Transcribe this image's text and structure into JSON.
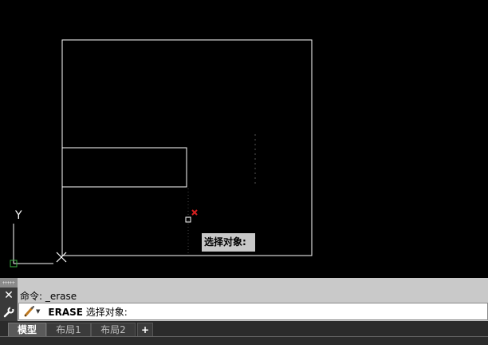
{
  "drawing": {
    "tooltip_text": "选择对象:",
    "ucs_y_label": "Y",
    "line_color": "#ffffff",
    "pickbox_color": "#ffffff",
    "marker_color": "#d42020"
  },
  "command_panel": {
    "history_line": "命令: _erase",
    "command_name": "ERASE",
    "prompt": " 选择对象:"
  },
  "layout_tabs": [
    {
      "label": "模型",
      "active": true
    },
    {
      "label": "布局1",
      "active": false
    },
    {
      "label": "布局2",
      "active": false
    },
    {
      "label": "+",
      "active": false
    }
  ]
}
